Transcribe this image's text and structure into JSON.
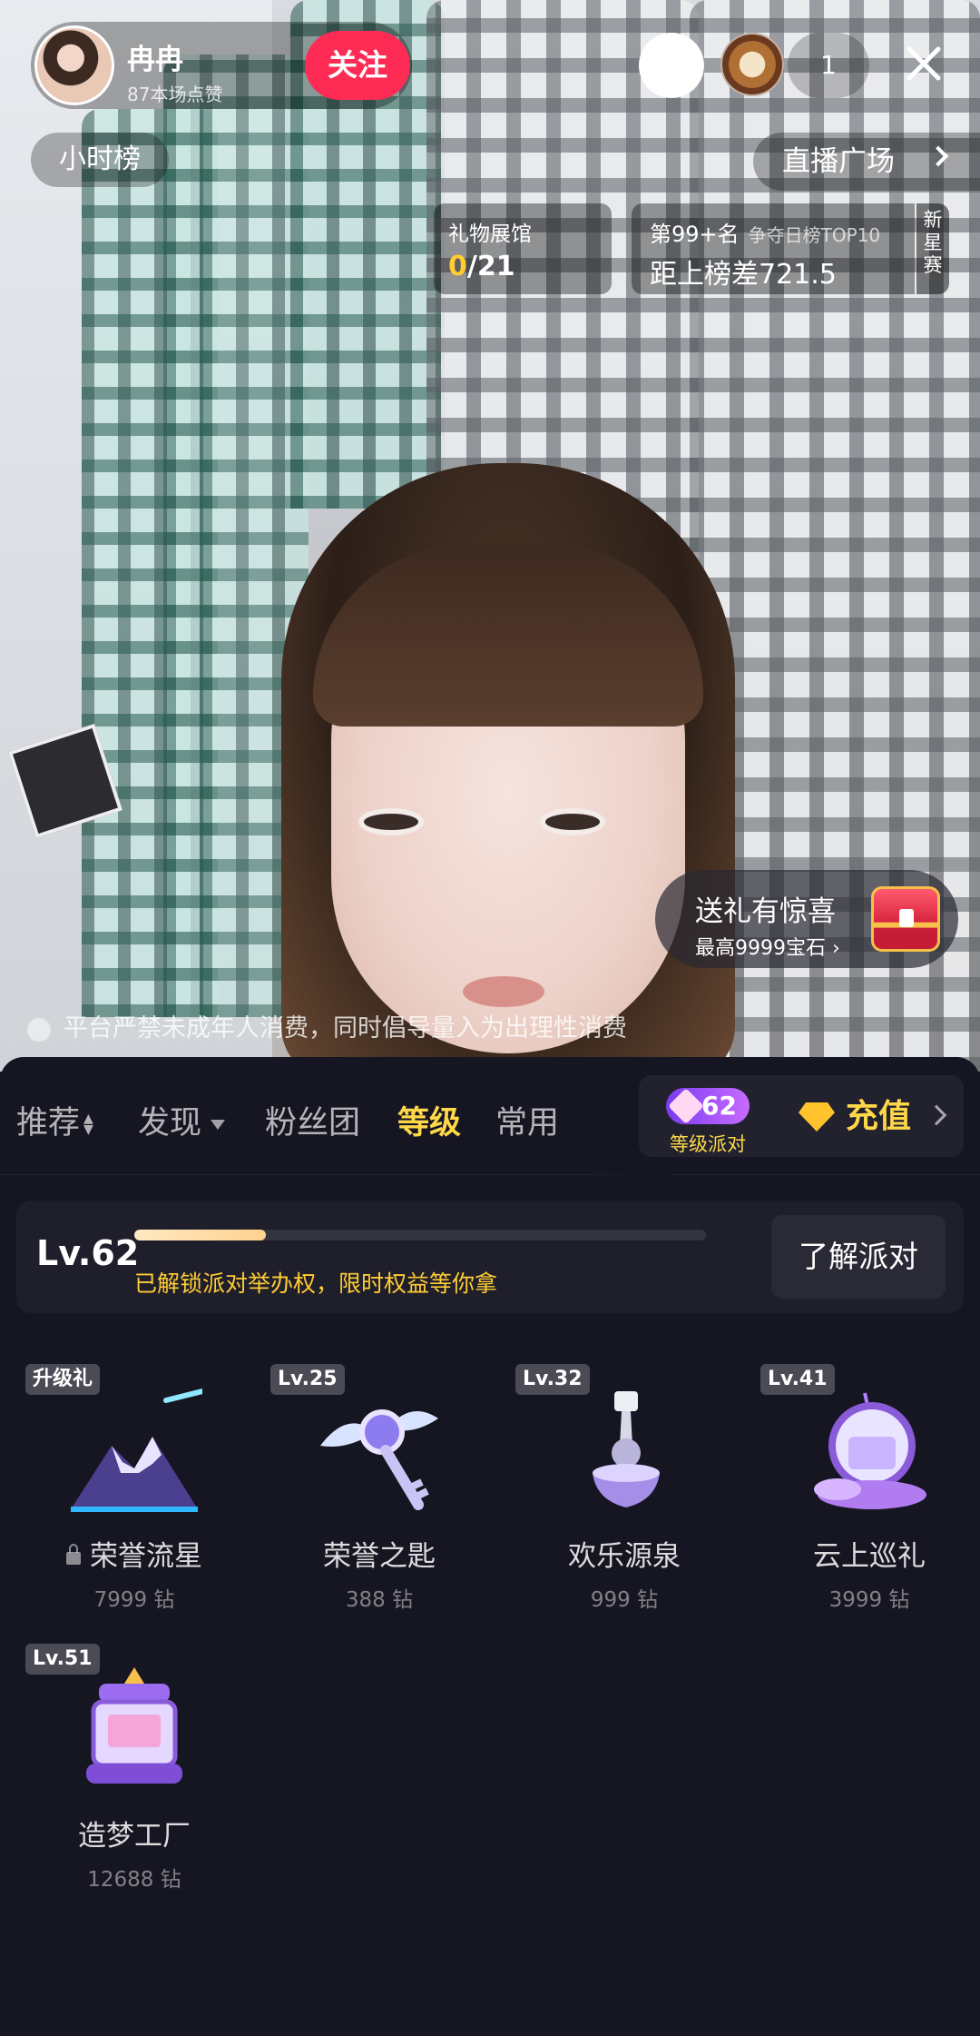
{
  "notice": "平台严禁未成年人消费，同时倡导量入为出理性消费",
  "host": {
    "name": "冉冉",
    "likes": "87本场点赞",
    "follow_label": "关注"
  },
  "viewers": {
    "count": "1"
  },
  "hour_rank": "小时榜",
  "plaza": "直播广场",
  "gift_hall": {
    "title": "礼物展馆",
    "current": "0",
    "total": "/21"
  },
  "rank": {
    "position": "第99+名",
    "sub": "争夺日榜TOP10",
    "gap": "距上榜差721.5",
    "newstar": "新星赛"
  },
  "surprise": {
    "title": "送礼有惊喜",
    "sub": "最高9999宝石"
  },
  "tabs": [
    "推荐",
    "发现",
    "粉丝团",
    "等级",
    "常用"
  ],
  "active_tab": "等级",
  "party": {
    "level": "62",
    "label": "等级派对"
  },
  "recharge": "充值",
  "level_card": {
    "level": "Lv.62",
    "desc": "已解锁派对举办权，限时权益等你拿",
    "progress": 0.23,
    "button": "了解派对"
  },
  "gifts": [
    {
      "tag": "升级礼",
      "name": "荣誉流星",
      "price": "7999 钻",
      "locked": true
    },
    {
      "tag": "Lv.25",
      "name": "荣誉之匙",
      "price": "388 钻",
      "locked": false
    },
    {
      "tag": "Lv.32",
      "name": "欢乐源泉",
      "price": "999 钻",
      "locked": false
    },
    {
      "tag": "Lv.41",
      "name": "云上巡礼",
      "price": "3999 钻",
      "locked": false
    },
    {
      "tag": "Lv.51",
      "name": "造梦工厂",
      "price": "12688 钻",
      "locked": false
    }
  ],
  "colors": {
    "accent": "#ffd84a",
    "follow": "#fe2c55",
    "panel": "#161622"
  }
}
